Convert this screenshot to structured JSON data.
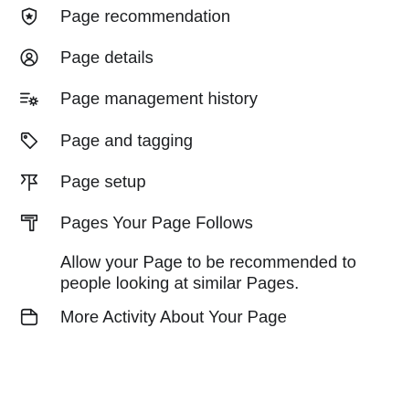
{
  "menu": {
    "items": [
      {
        "label": "Page recommendation",
        "icon": "shield-star-icon"
      },
      {
        "label": "Page details",
        "icon": "at-sign-icon"
      },
      {
        "label": "Page management history",
        "icon": "list-gear-icon"
      },
      {
        "label": "Page and tagging",
        "icon": "tag-icon"
      },
      {
        "label": "Page setup",
        "icon": "flag-icon"
      },
      {
        "label": "Pages Your Page Follows",
        "icon": "bookmark-icon"
      }
    ]
  },
  "recommendation": {
    "description": "Allow your Page to be recommended to people looking at similar Pages.",
    "more_label": "More Activity About Your Page",
    "more_icon": "activity-icon"
  },
  "colors": {
    "text": "#1c1e21",
    "background": "#ffffff"
  }
}
